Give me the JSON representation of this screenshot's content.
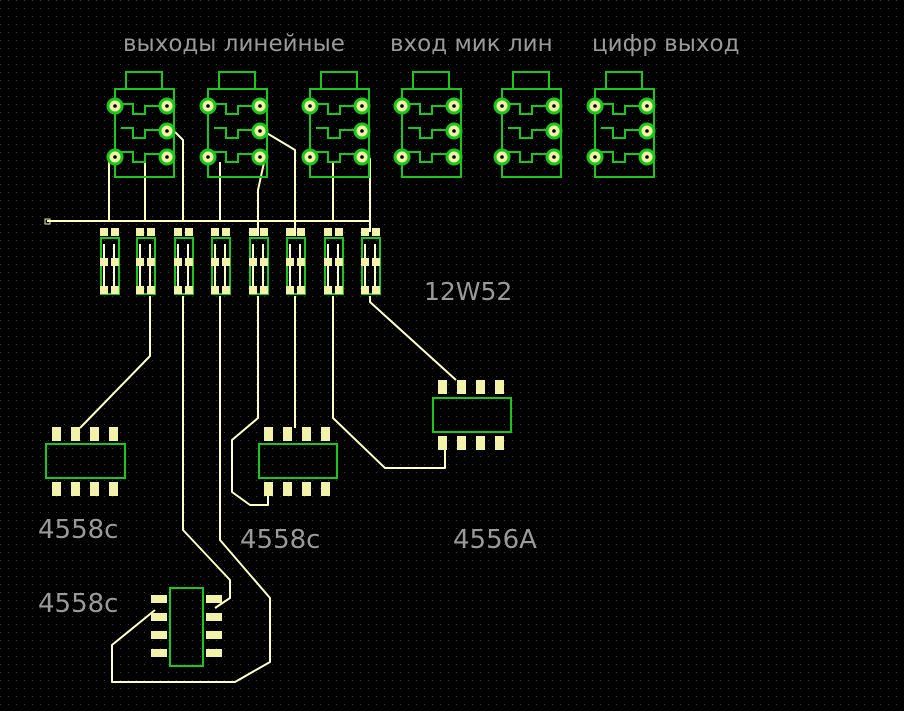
{
  "headers": {
    "outputs_line": "выходы линейные",
    "input_mic_line": "вход мик лин",
    "digital_output": "цифр выход"
  },
  "components": {
    "switch_label": "12W52",
    "ic_left": "4558c",
    "ic_middle": "4558c",
    "ic_right": "4556A",
    "ic_bottom": "4558c"
  },
  "colors": {
    "background": "#000000",
    "grid": "#3a3a3a",
    "trace": "#ffffc0",
    "outline": "#19c819",
    "pad": "#f2f2a8",
    "label": "#9a9a9a"
  }
}
